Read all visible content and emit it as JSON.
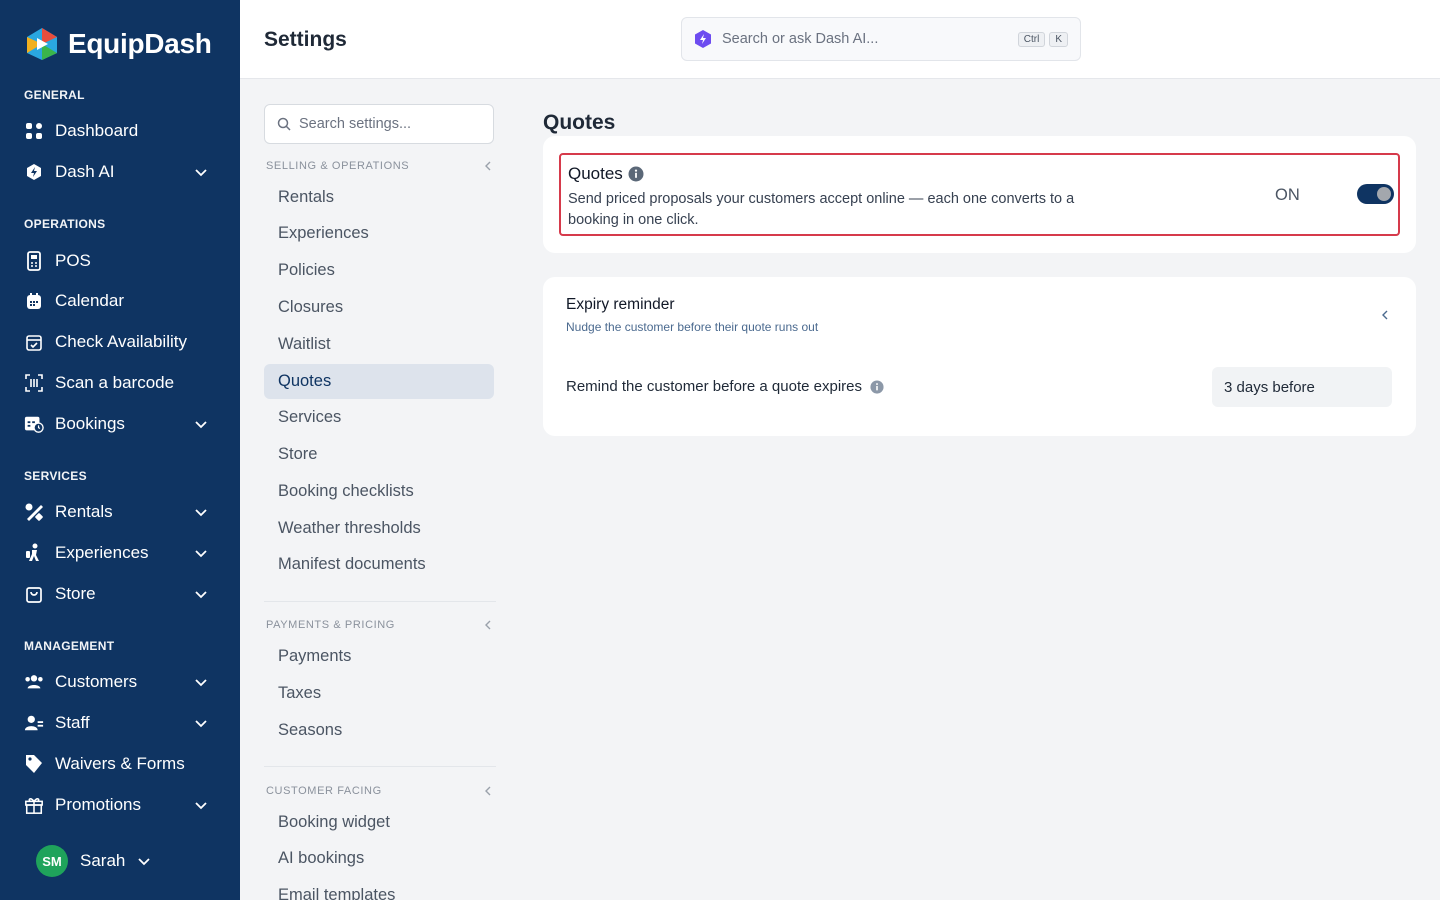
{
  "brand": {
    "name": "EquipDash"
  },
  "sidebar": {
    "sections": [
      {
        "label": "GENERAL",
        "items": [
          {
            "label": "Dashboard",
            "icon": "grid-icon",
            "expandable": false
          },
          {
            "label": "Dash AI",
            "icon": "ai-hex-icon",
            "expandable": true
          }
        ]
      },
      {
        "label": "OPERATIONS",
        "items": [
          {
            "label": "POS",
            "icon": "pos-terminal-icon",
            "expandable": false
          },
          {
            "label": "Calendar",
            "icon": "calendar-icon",
            "expandable": false
          },
          {
            "label": "Check Availability",
            "icon": "calendar-check-icon",
            "expandable": false
          },
          {
            "label": "Scan a barcode",
            "icon": "barcode-scan-icon",
            "expandable": false
          },
          {
            "label": "Bookings",
            "icon": "bookings-icon",
            "expandable": true
          }
        ]
      },
      {
        "label": "SERVICES",
        "items": [
          {
            "label": "Rentals",
            "icon": "rentals-tools-icon",
            "expandable": true
          },
          {
            "label": "Experiences",
            "icon": "experiences-icon",
            "expandable": true
          },
          {
            "label": "Store",
            "icon": "store-bag-icon",
            "expandable": true
          }
        ]
      },
      {
        "label": "MANAGEMENT",
        "items": [
          {
            "label": "Customers",
            "icon": "customers-icon",
            "expandable": true
          },
          {
            "label": "Staff",
            "icon": "staff-icon",
            "expandable": true
          },
          {
            "label": "Waivers & Forms",
            "icon": "tag-icon",
            "expandable": false
          },
          {
            "label": "Promotions",
            "icon": "gift-icon",
            "expandable": true
          }
        ]
      }
    ],
    "user": {
      "initials": "SM",
      "name": "Sarah"
    }
  },
  "header": {
    "title": "Settings",
    "search_placeholder": "Search or ask Dash AI...",
    "shortcut_keys": [
      "Ctrl",
      "K"
    ]
  },
  "settings_nav": {
    "search_placeholder": "Search settings...",
    "groups": [
      {
        "label": "SELLING & OPERATIONS",
        "items": [
          "Rentals",
          "Experiences",
          "Policies",
          "Closures",
          "Waitlist",
          "Quotes",
          "Services",
          "Store",
          "Booking checklists",
          "Weather thresholds",
          "Manifest documents"
        ]
      },
      {
        "label": "PAYMENTS & PRICING",
        "items": [
          "Payments",
          "Taxes",
          "Seasons"
        ]
      },
      {
        "label": "CUSTOMER FACING",
        "items": [
          "Booking widget",
          "AI bookings",
          "Email templates"
        ]
      }
    ],
    "active_item": "Quotes"
  },
  "main": {
    "title": "Quotes",
    "feature": {
      "title": "Quotes",
      "description": "Send priced proposals your customers accept online — each one converts to a booking in one click.",
      "state_label": "ON",
      "enabled": true
    },
    "expiry": {
      "title": "Expiry reminder",
      "subtitle": "Nudge the customer before their quote runs out",
      "remind_label": "Remind the customer before a quote expires",
      "remind_value": "3 days before"
    }
  },
  "colors": {
    "sidebar_bg": "#0f3462",
    "highlight_border": "#d63a4b",
    "toggle_on": "#0f3462",
    "avatar_bg": "#1fa35b"
  }
}
